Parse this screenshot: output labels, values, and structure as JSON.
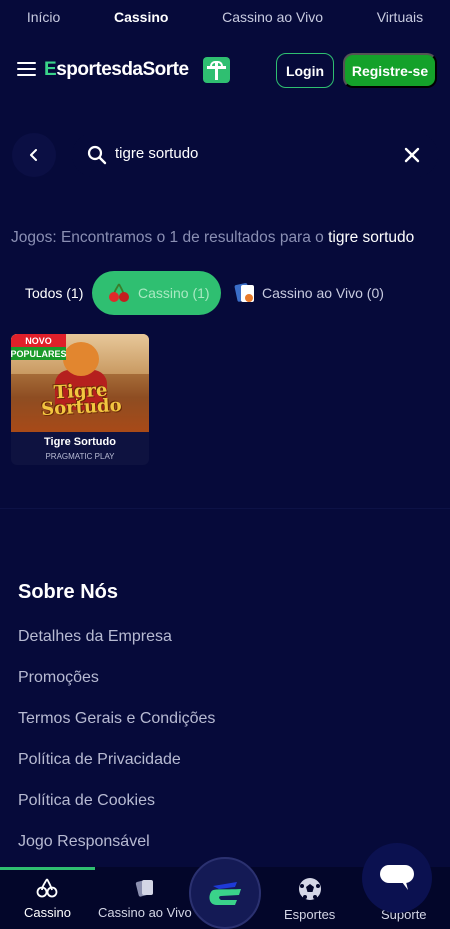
{
  "topnav": {
    "items": [
      "Início",
      "Cassino",
      "Cassino ao Vivo",
      "Virtuais"
    ]
  },
  "header": {
    "logo_prefix": "E",
    "logo_text": "sportesdaSorte",
    "login": "Login",
    "register": "Registre-se"
  },
  "search": {
    "value": "tigre sortudo"
  },
  "results": {
    "prefix": "Jogos: Encontramos o 1 de resultados para o ",
    "query": "tigre sortudo"
  },
  "tabs": {
    "all": "Todos (1)",
    "casino": "Cassino (1)",
    "live": "Cassino ao Vivo (0)"
  },
  "game": {
    "badge_new": "NOVO",
    "badge_popular": "POPULARES",
    "art_title_line1": "Tigre",
    "art_title_line2": "Sortudo",
    "name": "Tigre Sortudo",
    "provider": "PRAGMATIC PLAY"
  },
  "footer": {
    "title": "Sobre Nós",
    "links": [
      "Detalhes da Empresa",
      "Promoções",
      "Termos Gerais e Condições",
      "Política de Privacidade",
      "Política de Cookies",
      "Jogo Responsável"
    ]
  },
  "bottom_nav": {
    "casino": "Cassino",
    "live": "Cassino ao Vivo",
    "sports": "Esportes",
    "support": "Suporte"
  },
  "colors": {
    "background": "#060a3a",
    "accent": "#2fbf71",
    "register": "#14a12a"
  }
}
